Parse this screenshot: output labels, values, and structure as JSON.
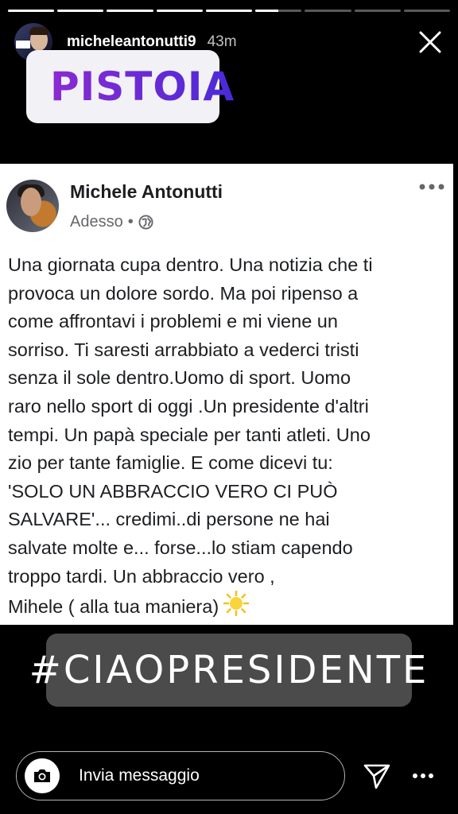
{
  "story": {
    "username": "micheleantonutti9",
    "time": "43m",
    "progress_segments": [
      1,
      1,
      1,
      1,
      1,
      0.5,
      0,
      0,
      0
    ]
  },
  "location_sticker": {
    "name": "PISTOIA",
    "icon": "map-pin-icon"
  },
  "post": {
    "author": "Michele Antonutti",
    "timestamp": "Adesso",
    "separator": "•",
    "privacy_icon": "globe-icon",
    "lines": [
      "Una giornata cupa dentro. Una notizia che ti",
      "provoca un  dolore sordo. Ma poi ripenso a",
      "come affrontavi i problemi e mi viene un",
      "sorriso. Ti saresti arrabbiato a vederci tristi",
      "senza il sole dentro.Uomo di sport. Uomo",
      "raro nello sport di oggi .Un presidente d'altri",
      "tempi. Un papà speciale per tanti atleti. Uno",
      "zio per tante famiglie. E come dicevi tu:",
      "'SOLO UN ABBRACCIO VERO CI PUÒ",
      "SALVARE'...  credimi..di persone ne hai",
      "salvate molte e... forse...lo stiam capendo",
      "troppo tardi.  Un abbraccio vero ,",
      "Mihele ( alla tua maniera)"
    ],
    "emoji": "sun-emoji"
  },
  "hashtag": "#CIAOPRESIDENTE",
  "composer": {
    "placeholder": "Invia messaggio"
  },
  "colors": {
    "background": "#000000",
    "sticker_gradient_start": "#8a2bd1",
    "sticker_gradient_end": "#4a2ad8",
    "hashtag_bg": "#4c4b4b"
  }
}
